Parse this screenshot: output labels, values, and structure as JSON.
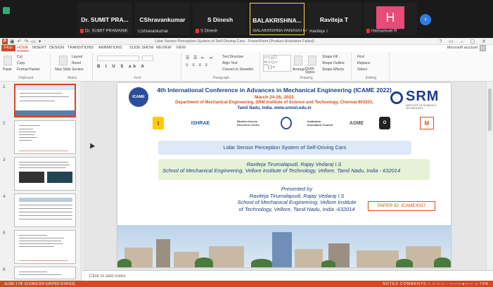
{
  "meeting": {
    "participants": [
      {
        "name": "Dr. SUMIT PRA...",
        "label": "Dr. SUMIT PRAMANIK"
      },
      {
        "name": "CShravankumar",
        "label": "CShravankumar"
      },
      {
        "name": "S Dinesh",
        "label": "S Dinesh"
      },
      {
        "name": "BALAKRISHNA...",
        "label": "BALAKRISHNA PANASATI-A..."
      },
      {
        "name": "Raviteja T",
        "label": "Raviteja T"
      },
      {
        "name": "H",
        "label": "Harisamuel R"
      }
    ]
  },
  "app": {
    "window_title": "Lidar Sensor Perception System of Self-Driving Cars - PowerPoint (Product Activation Failed)",
    "account": "Microsoft account"
  },
  "tabs": [
    "FILE",
    "HOME",
    "INSERT",
    "DESIGN",
    "TRANSITIONS",
    "ANIMATIONS",
    "SLIDE SHOW",
    "REVIEW",
    "VIEW"
  ],
  "ribbon": {
    "clipboard": {
      "label": "Clipboard",
      "paste": "Paste",
      "cut": "Cut",
      "copy": "Copy",
      "format_painter": "Format Painter"
    },
    "slides": {
      "label": "Slides",
      "new_slide": "New Slide",
      "layout": "Layout",
      "reset": "Reset",
      "section": "Section"
    },
    "font": {
      "label": "Font"
    },
    "paragraph": {
      "label": "Paragraph",
      "text_direction": "Text Direction",
      "align_text": "Align Text",
      "convert": "Convert to SmartArt"
    },
    "drawing": {
      "label": "Drawing",
      "arrange": "Arrange",
      "quick_styles": "Quick Styles",
      "shape_fill": "Shape Fill",
      "shape_outline": "Shape Outline",
      "shape_effects": "Shape Effects"
    },
    "editing": {
      "label": "Editing",
      "find": "Find",
      "replace": "Replace",
      "select": "Select"
    }
  },
  "thumbnails": [
    "1",
    "2",
    "3",
    "4",
    "5",
    "6"
  ],
  "slide": {
    "logo_left": "ICAME 2022",
    "title": "4th International Conference in Advances in Mechanical Engineering (ICAME 2022)",
    "date": "March 24-26, 2022",
    "dept": "Department of Mechanical Engineering, SRM Institute of Science and Technology, Chennai-603203,",
    "location": "Tamil Nadu, India. www.srmist.edu.in",
    "logo_right": "SRM",
    "logo_right_sub": "INSTITUTE OF SCIENCE & TECHNOLOGY",
    "sponsors": [
      "I",
      "ISHRAE",
      "Bhabha Atomic Research Centre",
      "",
      "Institution Innovation Council",
      "ASME",
      "O",
      "M"
    ],
    "paper_title": "Lidar Sensor Perception System of Self-Driving Cars",
    "authors": "Raviteja Tirumalapudi, Rajay Vedaraj I.S",
    "affiliation": "School of Mechanical Engineering, Vellore Institute of Technology, Vellore, Tamil Nadu, India - 632014",
    "presented_by": "Presented by",
    "presenter": "Raviteja Tirumalapudi, Rajay Vedaraj I.S",
    "presenter_aff1": "School of Mechanical Engineering, Vellore Institute",
    "presenter_aff2": "of Technology, Vellore, Tamil Nadu, India -632014",
    "paper_id": "PAPER ID: ICAME4337"
  },
  "notes_placeholder": "Click to add notes",
  "status": {
    "left": "SLIDE 1 OF 15    ENGLISH (UNITED STATES)",
    "right": "NOTES   COMMENTS   □  □  □  □   -  ———●——  +  70%"
  },
  "colors": {
    "accent": "#d24726",
    "conference_blue": "#1e3c8a",
    "conference_orange": "#d2531c"
  }
}
